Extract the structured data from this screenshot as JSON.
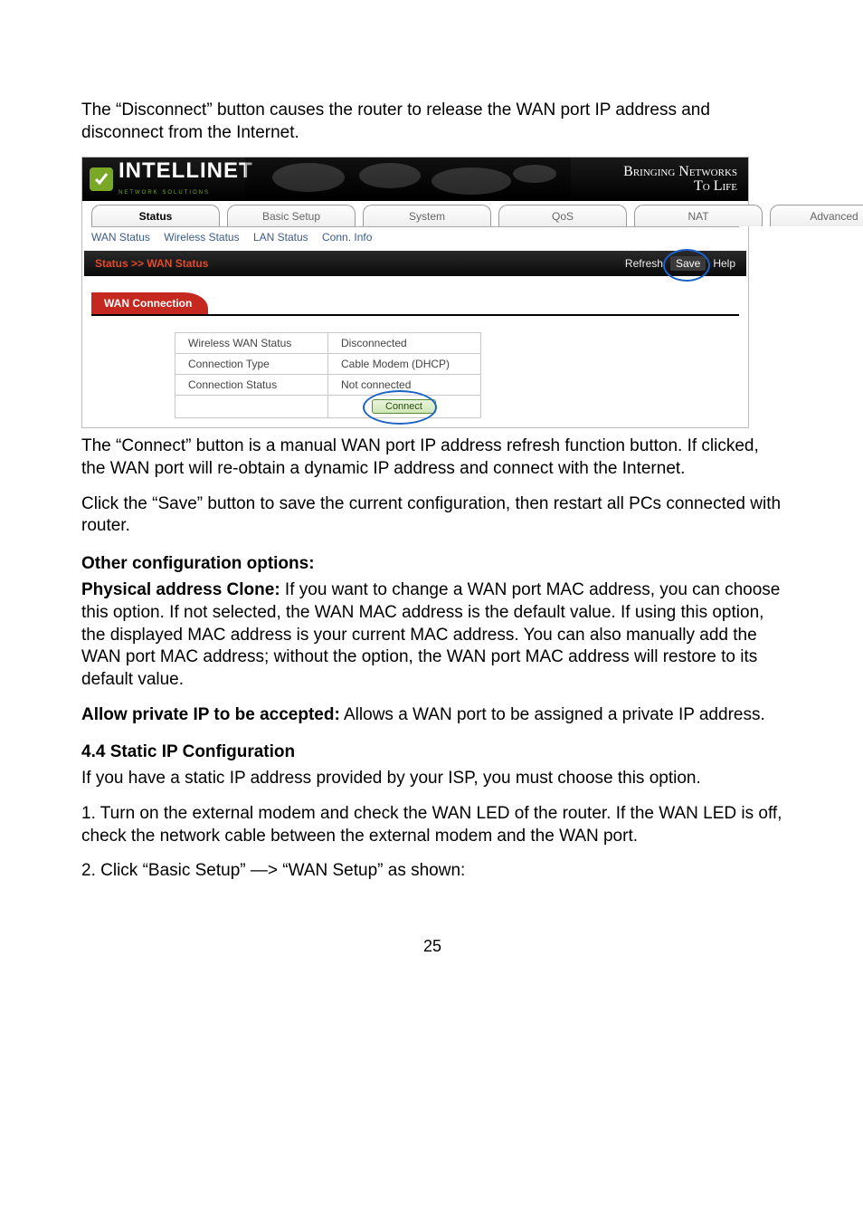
{
  "intro": "The “Disconnect” button causes the router to release the WAN port IP address and disconnect from the Internet.",
  "shot": {
    "brand": "INTELLINET",
    "brand_sub": "NETWORK SOLUTIONS",
    "tagline_top": "Bringing Networks",
    "tagline_bottom": "To Life",
    "tabs": [
      "Status",
      "Basic Setup",
      "System",
      "QoS",
      "NAT",
      "Advanced"
    ],
    "subnav": [
      "WAN Status",
      "Wireless Status",
      "LAN Status",
      "Conn. Info"
    ],
    "crumb": "Status >> WAN Status",
    "actions": {
      "refresh": "Refresh",
      "save": "Save",
      "help": "Help"
    },
    "section": "WAN Connection",
    "rows": [
      {
        "label": "Wireless WAN Status",
        "value": "Disconnected"
      },
      {
        "label": "Connection Type",
        "value": "Cable Modem (DHCP)"
      },
      {
        "label": "Connection Status",
        "value": "Not connected"
      }
    ],
    "connect": "Connect"
  },
  "after_connect": "The “Connect” button is a manual WAN port IP address refresh function button. If clicked, the WAN port will re-obtain a dynamic IP address and connect with the Internet.",
  "after_save": "Click the “Save” button to save the current configuration, then restart all PCs connected with router.",
  "other_heading": "Other configuration options:",
  "phys_label": "Physical address Clone:",
  "phys_text": " If you want to change a WAN port MAC address, you can choose this option. If not selected, the WAN MAC address is the default value. If using this option, the displayed MAC address is your current MAC address. You can also manually add the WAN port MAC address; without the option, the WAN port MAC address will restore to its default value.",
  "allow_label": "Allow private IP to be accepted:",
  "allow_text": " Allows a WAN port to be assigned a private IP address.",
  "sec44": "4.4 Static IP Configuration",
  "static1": "If you have a static IP address provided by your ISP, you must choose this option.",
  "static2": "1. Turn on the external modem and check the WAN LED of the router. If the WAN LED is off, check the network cable between the external modem and the WAN port.",
  "static3": "2. Click “Basic Setup” —> “WAN Setup” as shown:",
  "page": "25"
}
